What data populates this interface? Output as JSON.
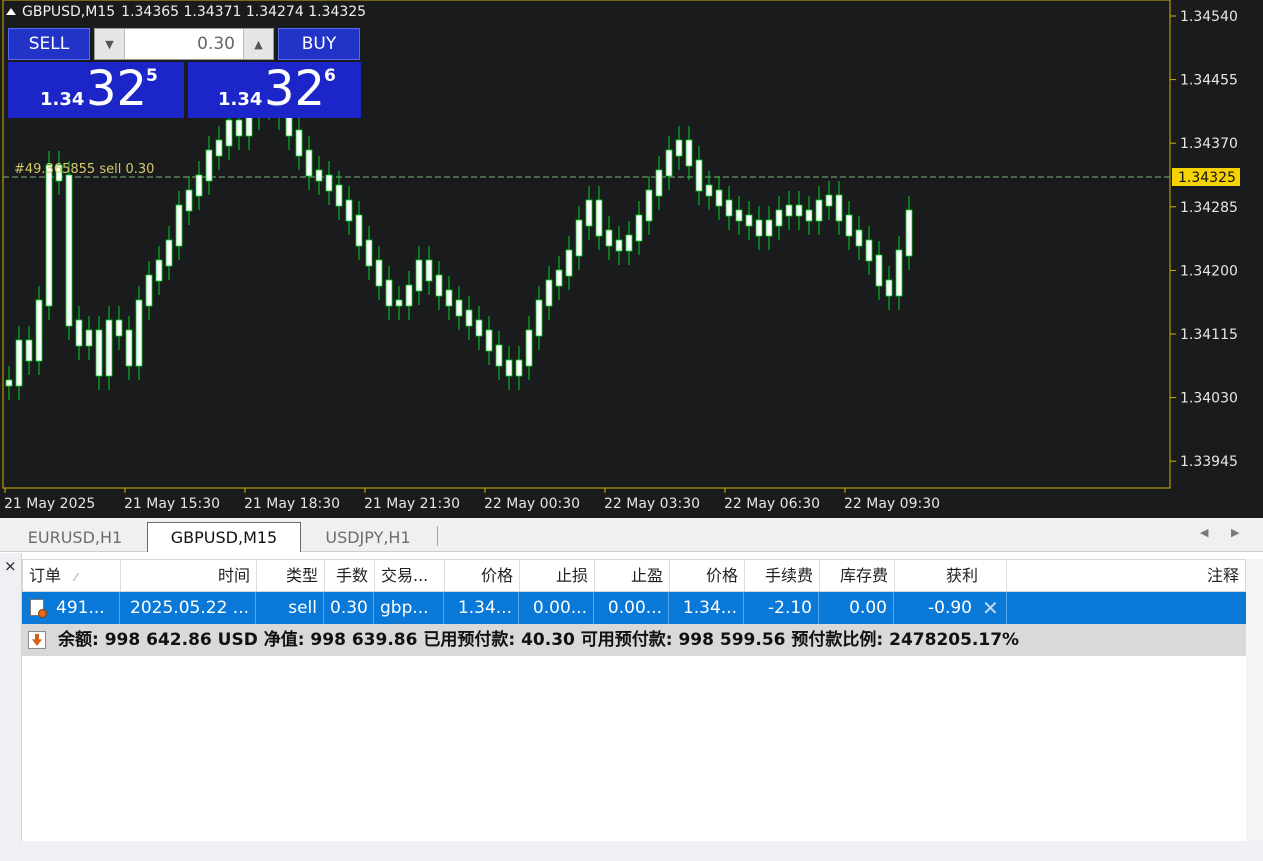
{
  "chart": {
    "symbol_header": "GBPUSD,M15",
    "ohlc": "1.34365 1.34371 1.34274 1.34325",
    "order_line_label": "#49.365855 sell 0.30",
    "price_ticks": [
      "1.34540",
      "1.34455",
      "1.34370",
      "1.34285",
      "1.34200",
      "1.34115",
      "1.34030",
      "1.33945"
    ],
    "current_price": "1.34325",
    "time_ticks": [
      "21 May 2025",
      "21 May 15:30",
      "21 May 18:30",
      "21 May 21:30",
      "22 May 00:30",
      "22 May 03:30",
      "22 May 06:30",
      "22 May 09:30"
    ],
    "colors": {
      "background": "#1a1b1d",
      "axis": "#d4b200",
      "bull_candle": "#ffffff",
      "bear_candle": "#ffffff",
      "wick": "#00d21f",
      "price_line": "#7ab37a",
      "current_price_bg": "#f5d300"
    }
  },
  "one_click": {
    "sell_label": "SELL",
    "buy_label": "BUY",
    "lot": "0.30",
    "sell_small": "1.34",
    "sell_big": "32",
    "sell_sup": "5",
    "buy_small": "1.34",
    "buy_big": "32",
    "buy_sup": "6"
  },
  "tabs": [
    {
      "label": "EURUSD,H1",
      "active": false
    },
    {
      "label": "GBPUSD,M15",
      "active": true
    },
    {
      "label": "USDJPY,H1",
      "active": false
    }
  ],
  "terminal": {
    "close_label": "×",
    "columns": [
      "订单",
      "时间",
      "类型",
      "手数",
      "交易...",
      "价格",
      "止损",
      "止盈",
      "价格",
      "手续费",
      "库存费",
      "获利",
      "注释"
    ],
    "order_row": [
      "491...",
      "2025.05.22 ...",
      "sell",
      "0.30",
      "gbp...",
      "1.34...",
      "0.00...",
      "0.00...",
      "1.34...",
      "-2.10",
      "0.00",
      "-0.90"
    ],
    "balance_line": "余额: 998 642.86 USD  净值: 998 639.86  已用预付款: 40.30  可用预付款: 998 599.56  预付款比例: 2478205.17%"
  }
}
